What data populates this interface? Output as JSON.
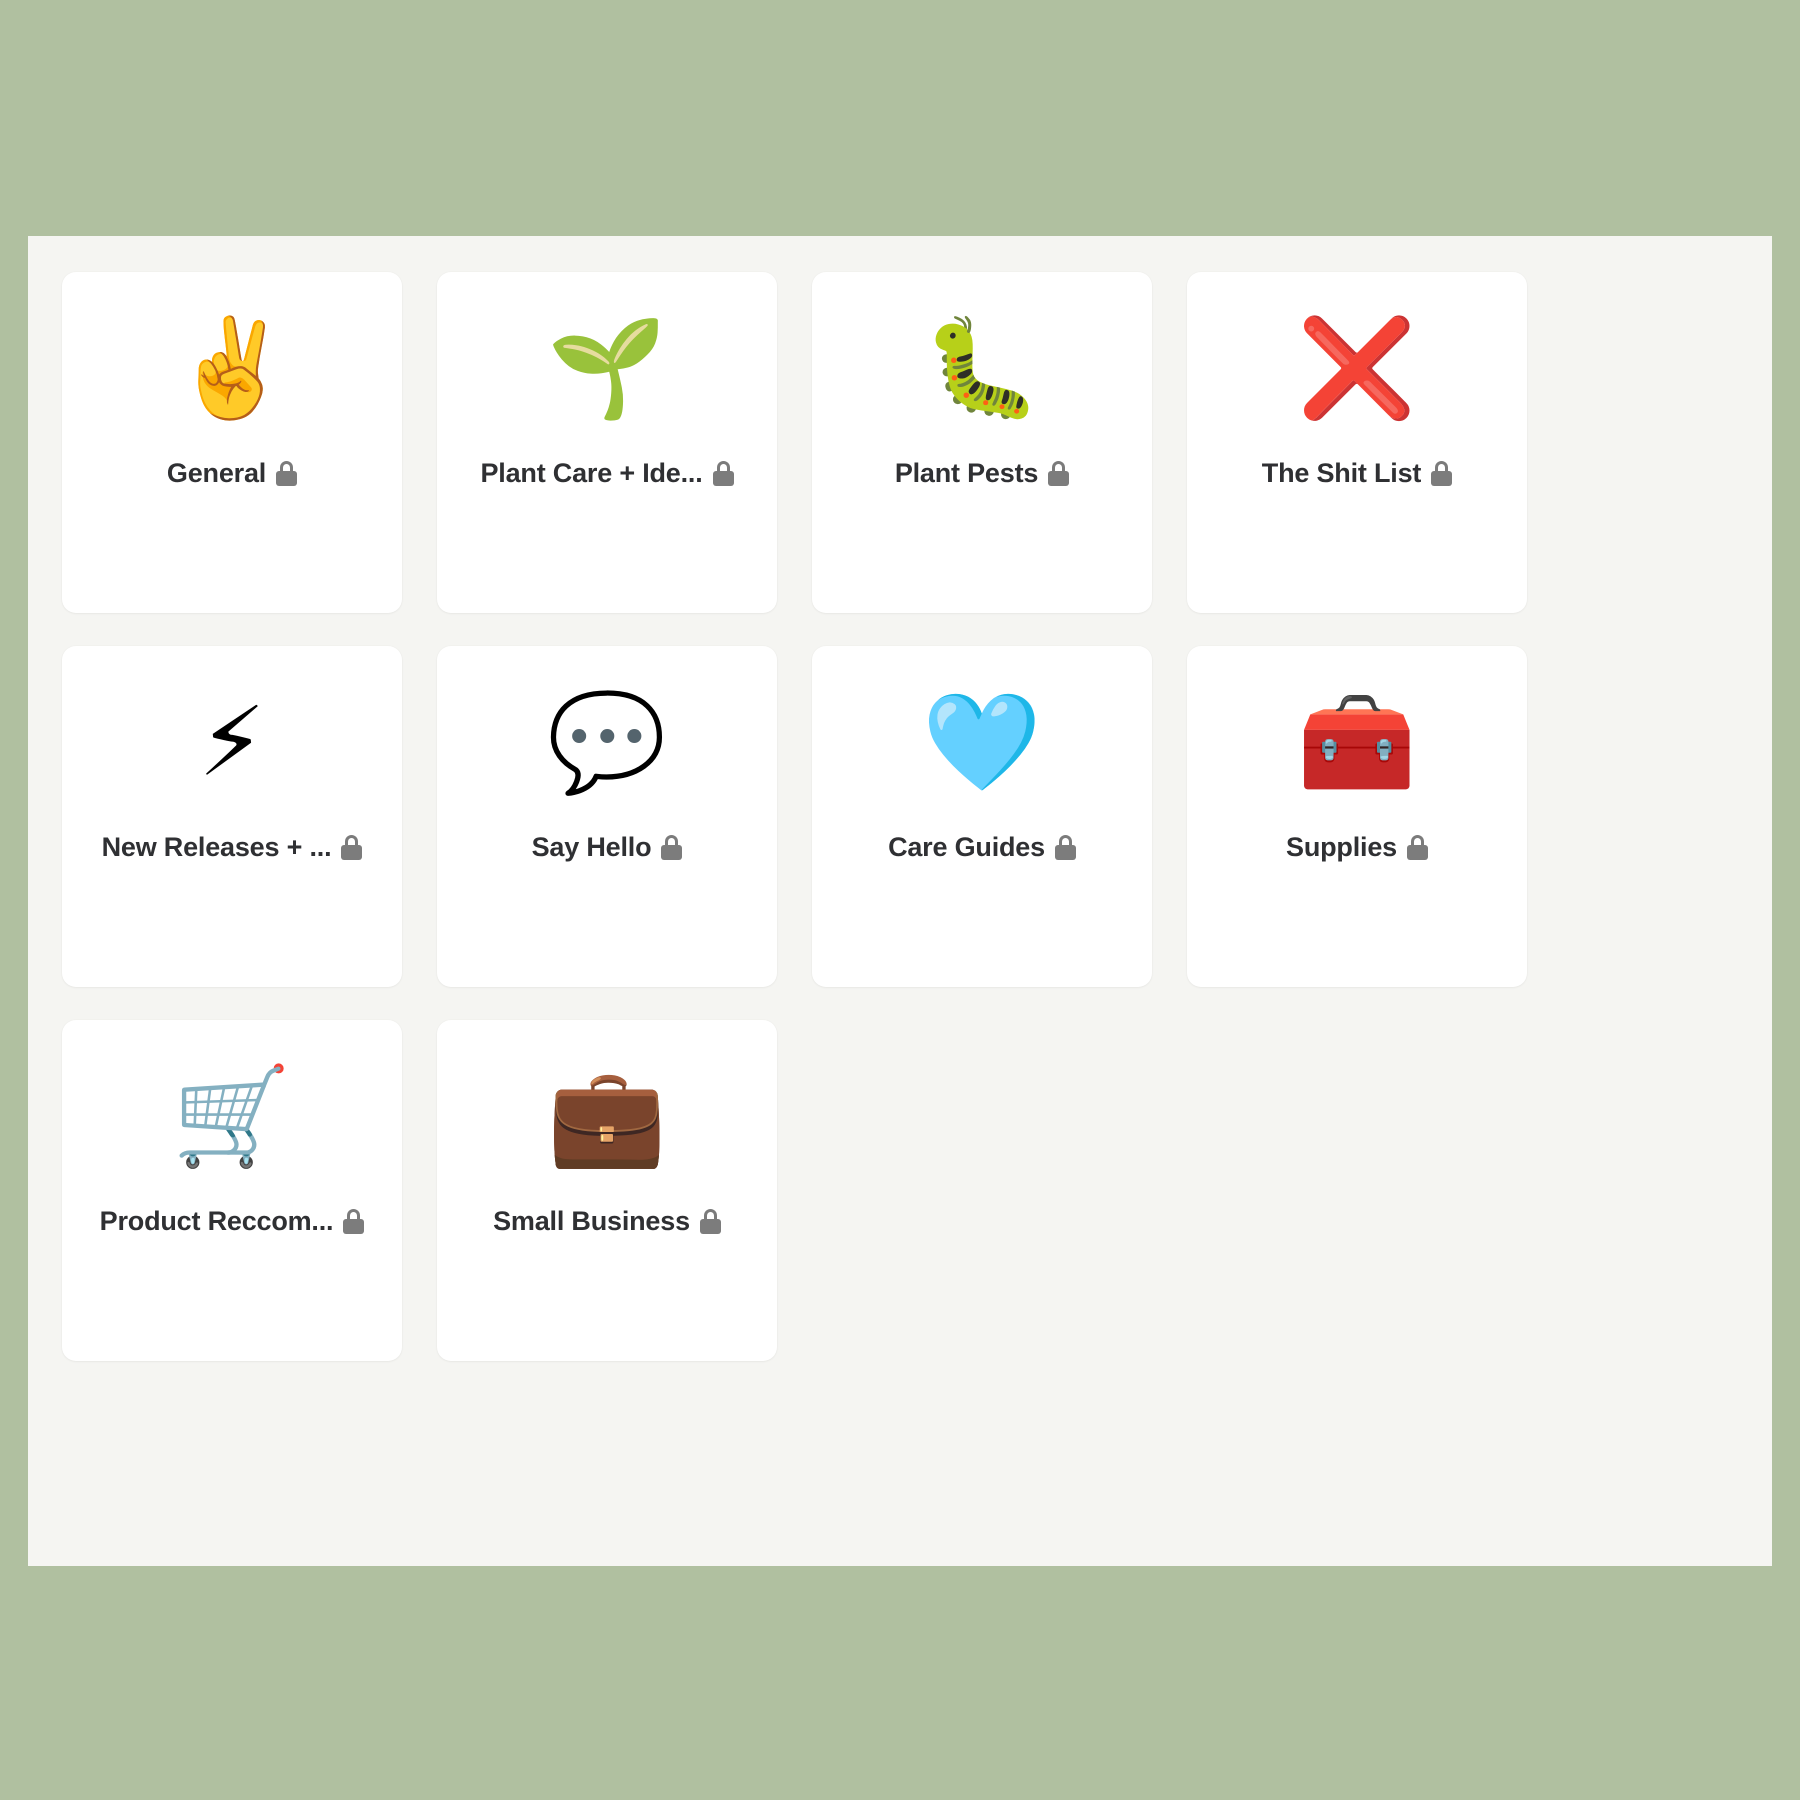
{
  "theme": {
    "page_background": "#b0c0a0",
    "panel_background": "#f5f5f2",
    "card_background": "#ffffff",
    "label_color": "#2f3033",
    "lock_color": "#7c7c7c"
  },
  "grid": {
    "columns": 4,
    "cards": [
      {
        "emoji": "✌️",
        "icon_name": "victory-hand-emoji",
        "label": "General",
        "locked": true,
        "lock_label": "locked"
      },
      {
        "emoji": "🌱",
        "icon_name": "seedling-emoji",
        "label": "Plant Care + Ide...",
        "locked": true,
        "lock_label": "locked"
      },
      {
        "emoji": "🐛",
        "icon_name": "caterpillar-bug-emoji",
        "label": "Plant Pests",
        "locked": true,
        "lock_label": "locked"
      },
      {
        "emoji": "❌",
        "icon_name": "cross-mark-emoji",
        "label": "The Shit List",
        "locked": true,
        "lock_label": "locked"
      },
      {
        "emoji": "⚡",
        "icon_name": "high-voltage-emoji",
        "label": "New Releases + ...",
        "locked": true,
        "lock_label": "locked"
      },
      {
        "emoji": "💬",
        "icon_name": "speech-balloon-emoji",
        "label": "Say Hello",
        "locked": true,
        "lock_label": "locked"
      },
      {
        "emoji": "🩵",
        "icon_name": "white-heart-emoji",
        "label": "Care Guides",
        "locked": true,
        "lock_label": "locked"
      },
      {
        "emoji": "🧰",
        "icon_name": "toolbox-emoji",
        "label": "Supplies",
        "locked": true,
        "lock_label": "locked"
      },
      {
        "emoji": "🛒",
        "icon_name": "shopping-cart-emoji",
        "label": "Product Reccom...",
        "locked": true,
        "lock_label": "locked"
      },
      {
        "emoji": "💼",
        "icon_name": "briefcase-emoji",
        "label": "Small Business",
        "locked": true,
        "lock_label": "locked"
      }
    ]
  }
}
